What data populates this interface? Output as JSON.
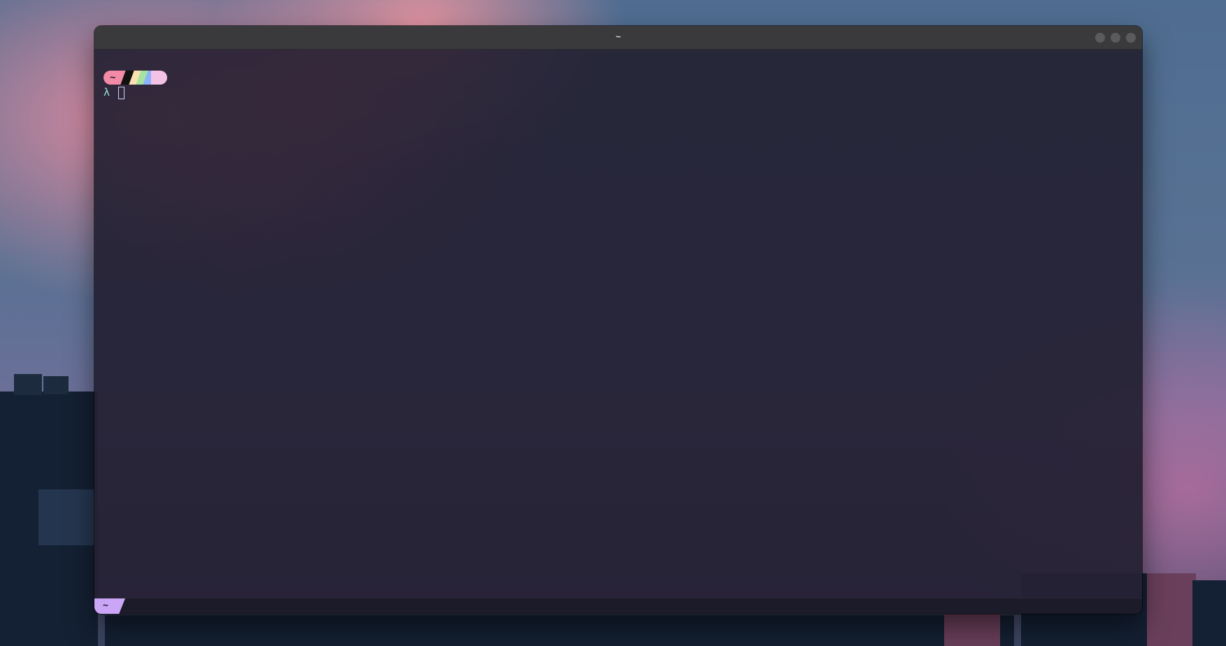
{
  "window": {
    "title": "~"
  },
  "prompt": {
    "path": "~",
    "symbol": "λ"
  },
  "tabbar": {
    "active_tab": "~"
  },
  "colors": {
    "prompt_path_bg": "#f38ba8",
    "prompt_end_bg": "#f5c2e7",
    "lambda": "#94e2d5",
    "tab_active_bg": "#cba6f7",
    "titlebar_bg": "#3a3a3c"
  }
}
